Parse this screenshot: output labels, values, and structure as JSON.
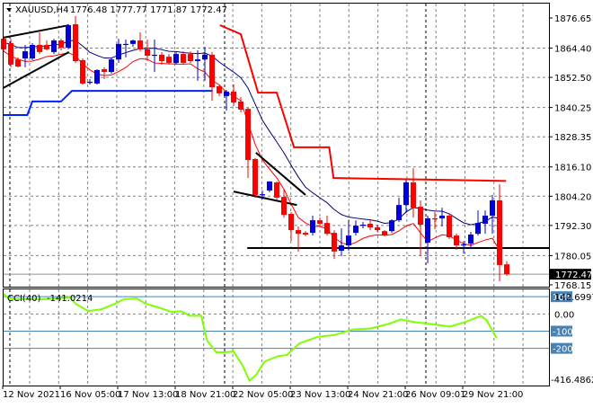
{
  "header": {
    "symbol": "XAUUSD,H4",
    "ohlc": "1776.48 1777.77 1771.87 1772.47"
  },
  "colors": {
    "bull": "#0000dd",
    "bear": "#ff0000",
    "ma_slow": "#000080",
    "ma_fast": "#ff0000",
    "step_low": "#0022ff",
    "step_high": "#ff0000",
    "cci": "#7fff00",
    "level": "#4682b4",
    "grid": "#808080"
  },
  "chart_data": [
    {
      "type": "candlestick",
      "title": "XAUUSD,H4",
      "ylim": [
        1768.15,
        1876.65
      ],
      "price_ticks": [
        "1876.65",
        "1864.40",
        "1852.50",
        "1840.25",
        "1828.35",
        "1816.10",
        "1804.20",
        "1792.30",
        "1780.05",
        "1768.15"
      ],
      "price_tick_values": [
        1876.65,
        1864.4,
        1852.5,
        1840.25,
        1828.35,
        1816.1,
        1804.2,
        1792.3,
        1780.05,
        1768.15
      ],
      "current_price": "1772.47",
      "current_price_value": 1772.47,
      "x_labels": [
        "12 Nov 2021",
        "16 Nov 05:00",
        "17 Nov 13:00",
        "18 Nov 21:00",
        "22 Nov 05:00",
        "23 Nov 13:00",
        "24 Nov 21:00",
        "26 Nov 09:01",
        "29 Nov 21:00"
      ],
      "x_label_index": [
        0,
        8,
        16,
        24,
        32,
        40,
        48,
        56,
        64
      ],
      "candles_ohlc": [
        [
          1868.2,
          1869.3,
          1863.1,
          1863.9
        ],
        [
          1866.4,
          1868.2,
          1856.6,
          1857.7
        ],
        [
          1859.8,
          1860.6,
          1856.6,
          1856.9
        ],
        [
          1860.2,
          1865.7,
          1856.6,
          1863.1
        ],
        [
          1860.2,
          1866.4,
          1859.5,
          1865.7
        ],
        [
          1865.7,
          1870.8,
          1862.0,
          1862.8
        ],
        [
          1865.7,
          1867.5,
          1863.5,
          1863.9
        ],
        [
          1862.8,
          1868.2,
          1862.0,
          1867.5
        ],
        [
          1867.5,
          1868.2,
          1863.5,
          1864.6
        ],
        [
          1864.6,
          1874.1,
          1863.9,
          1873.7
        ],
        [
          1874.1,
          1877.4,
          1858.4,
          1859.1
        ],
        [
          1859.5,
          1860.2,
          1849.6,
          1850.0
        ],
        [
          1850.3,
          1851.8,
          1849.6,
          1850.7
        ],
        [
          1850.0,
          1855.8,
          1849.6,
          1855.5
        ],
        [
          1855.8,
          1856.6,
          1851.8,
          1854.7
        ],
        [
          1854.7,
          1860.6,
          1854.0,
          1859.8
        ],
        [
          1859.8,
          1868.2,
          1858.4,
          1866.1
        ],
        [
          1865.7,
          1867.9,
          1860.6,
          1866.1
        ],
        [
          1866.1,
          1867.9,
          1864.9,
          1867.5
        ],
        [
          1867.5,
          1870.8,
          1863.1,
          1863.9
        ],
        [
          1863.9,
          1867.9,
          1859.1,
          1861.3
        ],
        [
          1861.3,
          1867.9,
          1854.7,
          1861.7
        ],
        [
          1861.7,
          1862.8,
          1857.7,
          1859.1
        ],
        [
          1860.9,
          1862.0,
          1857.7,
          1858.4
        ],
        [
          1858.4,
          1862.8,
          1857.7,
          1862.0
        ],
        [
          1862.0,
          1863.1,
          1857.7,
          1858.4
        ],
        [
          1862.0,
          1863.1,
          1858.4,
          1859.1
        ],
        [
          1859.1,
          1863.5,
          1851.1,
          1859.8
        ],
        [
          1859.8,
          1864.9,
          1851.1,
          1861.7
        ],
        [
          1861.7,
          1862.8,
          1843.0,
          1848.5
        ],
        [
          1848.9,
          1849.6,
          1844.9,
          1846.0
        ],
        [
          1844.9,
          1847.4,
          1839.0,
          1846.7
        ],
        [
          1846.7,
          1849.6,
          1840.9,
          1842.3
        ],
        [
          1842.7,
          1844.5,
          1838.3,
          1839.4
        ],
        [
          1839.7,
          1840.1,
          1811.6,
          1818.9
        ],
        [
          1819.3,
          1819.7,
          1803.6,
          1804.7
        ],
        [
          1805.0,
          1806.5,
          1802.9,
          1805.0
        ],
        [
          1806.5,
          1810.2,
          1805.8,
          1810.2
        ],
        [
          1809.8,
          1810.2,
          1802.9,
          1803.6
        ],
        [
          1803.9,
          1807.3,
          1795.5,
          1796.6
        ],
        [
          1797.0,
          1797.7,
          1786.0,
          1790.4
        ],
        [
          1790.4,
          1791.9,
          1781.7,
          1788.9
        ],
        [
          1789.3,
          1790.0,
          1787.9,
          1788.6
        ],
        [
          1789.3,
          1796.3,
          1788.2,
          1794.4
        ],
        [
          1794.4,
          1795.5,
          1792.2,
          1793.0
        ],
        [
          1793.3,
          1796.3,
          1788.2,
          1788.9
        ],
        [
          1789.3,
          1790.4,
          1778.7,
          1781.7
        ],
        [
          1782.0,
          1791.1,
          1779.8,
          1784.2
        ],
        [
          1784.2,
          1794.4,
          1782.0,
          1788.2
        ],
        [
          1789.3,
          1794.4,
          1788.2,
          1792.2
        ],
        [
          1792.2,
          1793.7,
          1791.1,
          1792.6
        ],
        [
          1793.0,
          1794.8,
          1790.4,
          1791.5
        ],
        [
          1791.5,
          1792.6,
          1789.7,
          1790.4
        ],
        [
          1790.0,
          1790.4,
          1787.9,
          1788.2
        ],
        [
          1790.0,
          1794.8,
          1789.3,
          1794.4
        ],
        [
          1794.4,
          1803.6,
          1793.7,
          1800.6
        ],
        [
          1800.6,
          1810.9,
          1797.3,
          1809.8
        ],
        [
          1809.8,
          1815.6,
          1795.5,
          1799.5
        ],
        [
          1799.9,
          1802.5,
          1779.8,
          1792.6
        ],
        [
          1785.3,
          1796.3,
          1776.9,
          1795.2
        ],
        [
          1795.2,
          1797.7,
          1790.8,
          1794.8
        ],
        [
          1795.2,
          1799.5,
          1791.9,
          1796.3
        ],
        [
          1796.3,
          1797.0,
          1786.8,
          1787.5
        ],
        [
          1788.2,
          1789.0,
          1782.4,
          1784.2
        ],
        [
          1784.2,
          1786.0,
          1780.9,
          1784.6
        ],
        [
          1784.9,
          1789.7,
          1782.7,
          1788.6
        ],
        [
          1788.9,
          1798.4,
          1788.2,
          1793.3
        ],
        [
          1793.0,
          1798.4,
          1788.9,
          1796.3
        ],
        [
          1796.3,
          1804.7,
          1788.9,
          1802.5
        ],
        [
          1802.5,
          1809.1,
          1769.6,
          1776.2
        ],
        [
          1776.48,
          1777.77,
          1771.87,
          1772.47
        ]
      ],
      "step_low_line": [
        [
          -0.1,
          1837.2
        ],
        [
          3.3,
          1837.2
        ],
        [
          4,
          1842.7
        ],
        [
          8,
          1842.7
        ],
        [
          9.5,
          1847.0
        ],
        [
          29.1,
          1847.0
        ]
      ],
      "step_high_line": [
        [
          30.1,
          1873.7
        ],
        [
          33,
          1870.1
        ],
        [
          35.4,
          1846.3
        ],
        [
          38,
          1846.3
        ],
        [
          40.4,
          1824.1
        ],
        [
          45.3,
          1824.1
        ],
        [
          45.9,
          1811.6
        ],
        [
          69.9,
          1810.4
        ]
      ],
      "trendlines": [
        [
          [
            -0.1,
            1868.6
          ],
          [
            9.1,
            1873.7
          ]
        ],
        [
          [
            -0.1,
            1848.1
          ],
          [
            9.1,
            1862.8
          ]
        ],
        [
          [
            35.1,
            1821.9
          ],
          [
            42,
            1804.7
          ]
        ],
        [
          [
            32,
            1806.1
          ],
          [
            40.8,
            1800.6
          ]
        ],
        [
          [
            33.9,
            1783.1
          ],
          [
            76,
            1783.1
          ]
        ]
      ]
    },
    {
      "type": "line",
      "title": "CCI(40)",
      "last_value": "-141.0214",
      "ylim": [
        -416.4862,
        142.6997
      ],
      "top_label": "142.6997",
      "bottom_label": "-416.4862",
      "levels": [
        {
          "label": "100",
          "value": 100,
          "boxed": true
        },
        {
          "label": "0.00",
          "value": 0,
          "boxed": false
        },
        {
          "label": "-100",
          "value": -100,
          "boxed": true
        },
        {
          "label": "-200",
          "value": -200,
          "boxed": true
        }
      ],
      "points": [
        [
          0,
          117
        ],
        [
          0.7,
          90
        ],
        [
          2,
          85
        ],
        [
          5.6,
          85
        ],
        [
          9.3,
          96
        ],
        [
          10,
          59
        ],
        [
          11.8,
          16
        ],
        [
          13.6,
          27
        ],
        [
          15.5,
          59
        ],
        [
          16.7,
          85
        ],
        [
          18.5,
          90
        ],
        [
          19.8,
          59
        ],
        [
          21.6,
          37
        ],
        [
          23.4,
          11
        ],
        [
          24.7,
          16
        ],
        [
          25.9,
          -11
        ],
        [
          27.5,
          -11
        ],
        [
          28.3,
          -154
        ],
        [
          29.6,
          -223
        ],
        [
          30.8,
          -223
        ],
        [
          32,
          -218
        ],
        [
          33.3,
          -303
        ],
        [
          34.2,
          -388
        ],
        [
          35.1,
          -356
        ],
        [
          36.3,
          -277
        ],
        [
          38.2,
          -245
        ],
        [
          39.4,
          -239
        ],
        [
          41.2,
          -170
        ],
        [
          43.7,
          -133
        ],
        [
          46.1,
          -122
        ],
        [
          48.6,
          -90
        ],
        [
          51,
          -85
        ],
        [
          53.5,
          -59
        ],
        [
          55.3,
          -32
        ],
        [
          57.2,
          -48
        ],
        [
          59.6,
          -59
        ],
        [
          62.1,
          -74
        ],
        [
          64.5,
          -43
        ],
        [
          66.4,
          -11
        ],
        [
          67.2,
          -37
        ],
        [
          68.6,
          -141
        ]
      ]
    }
  ]
}
